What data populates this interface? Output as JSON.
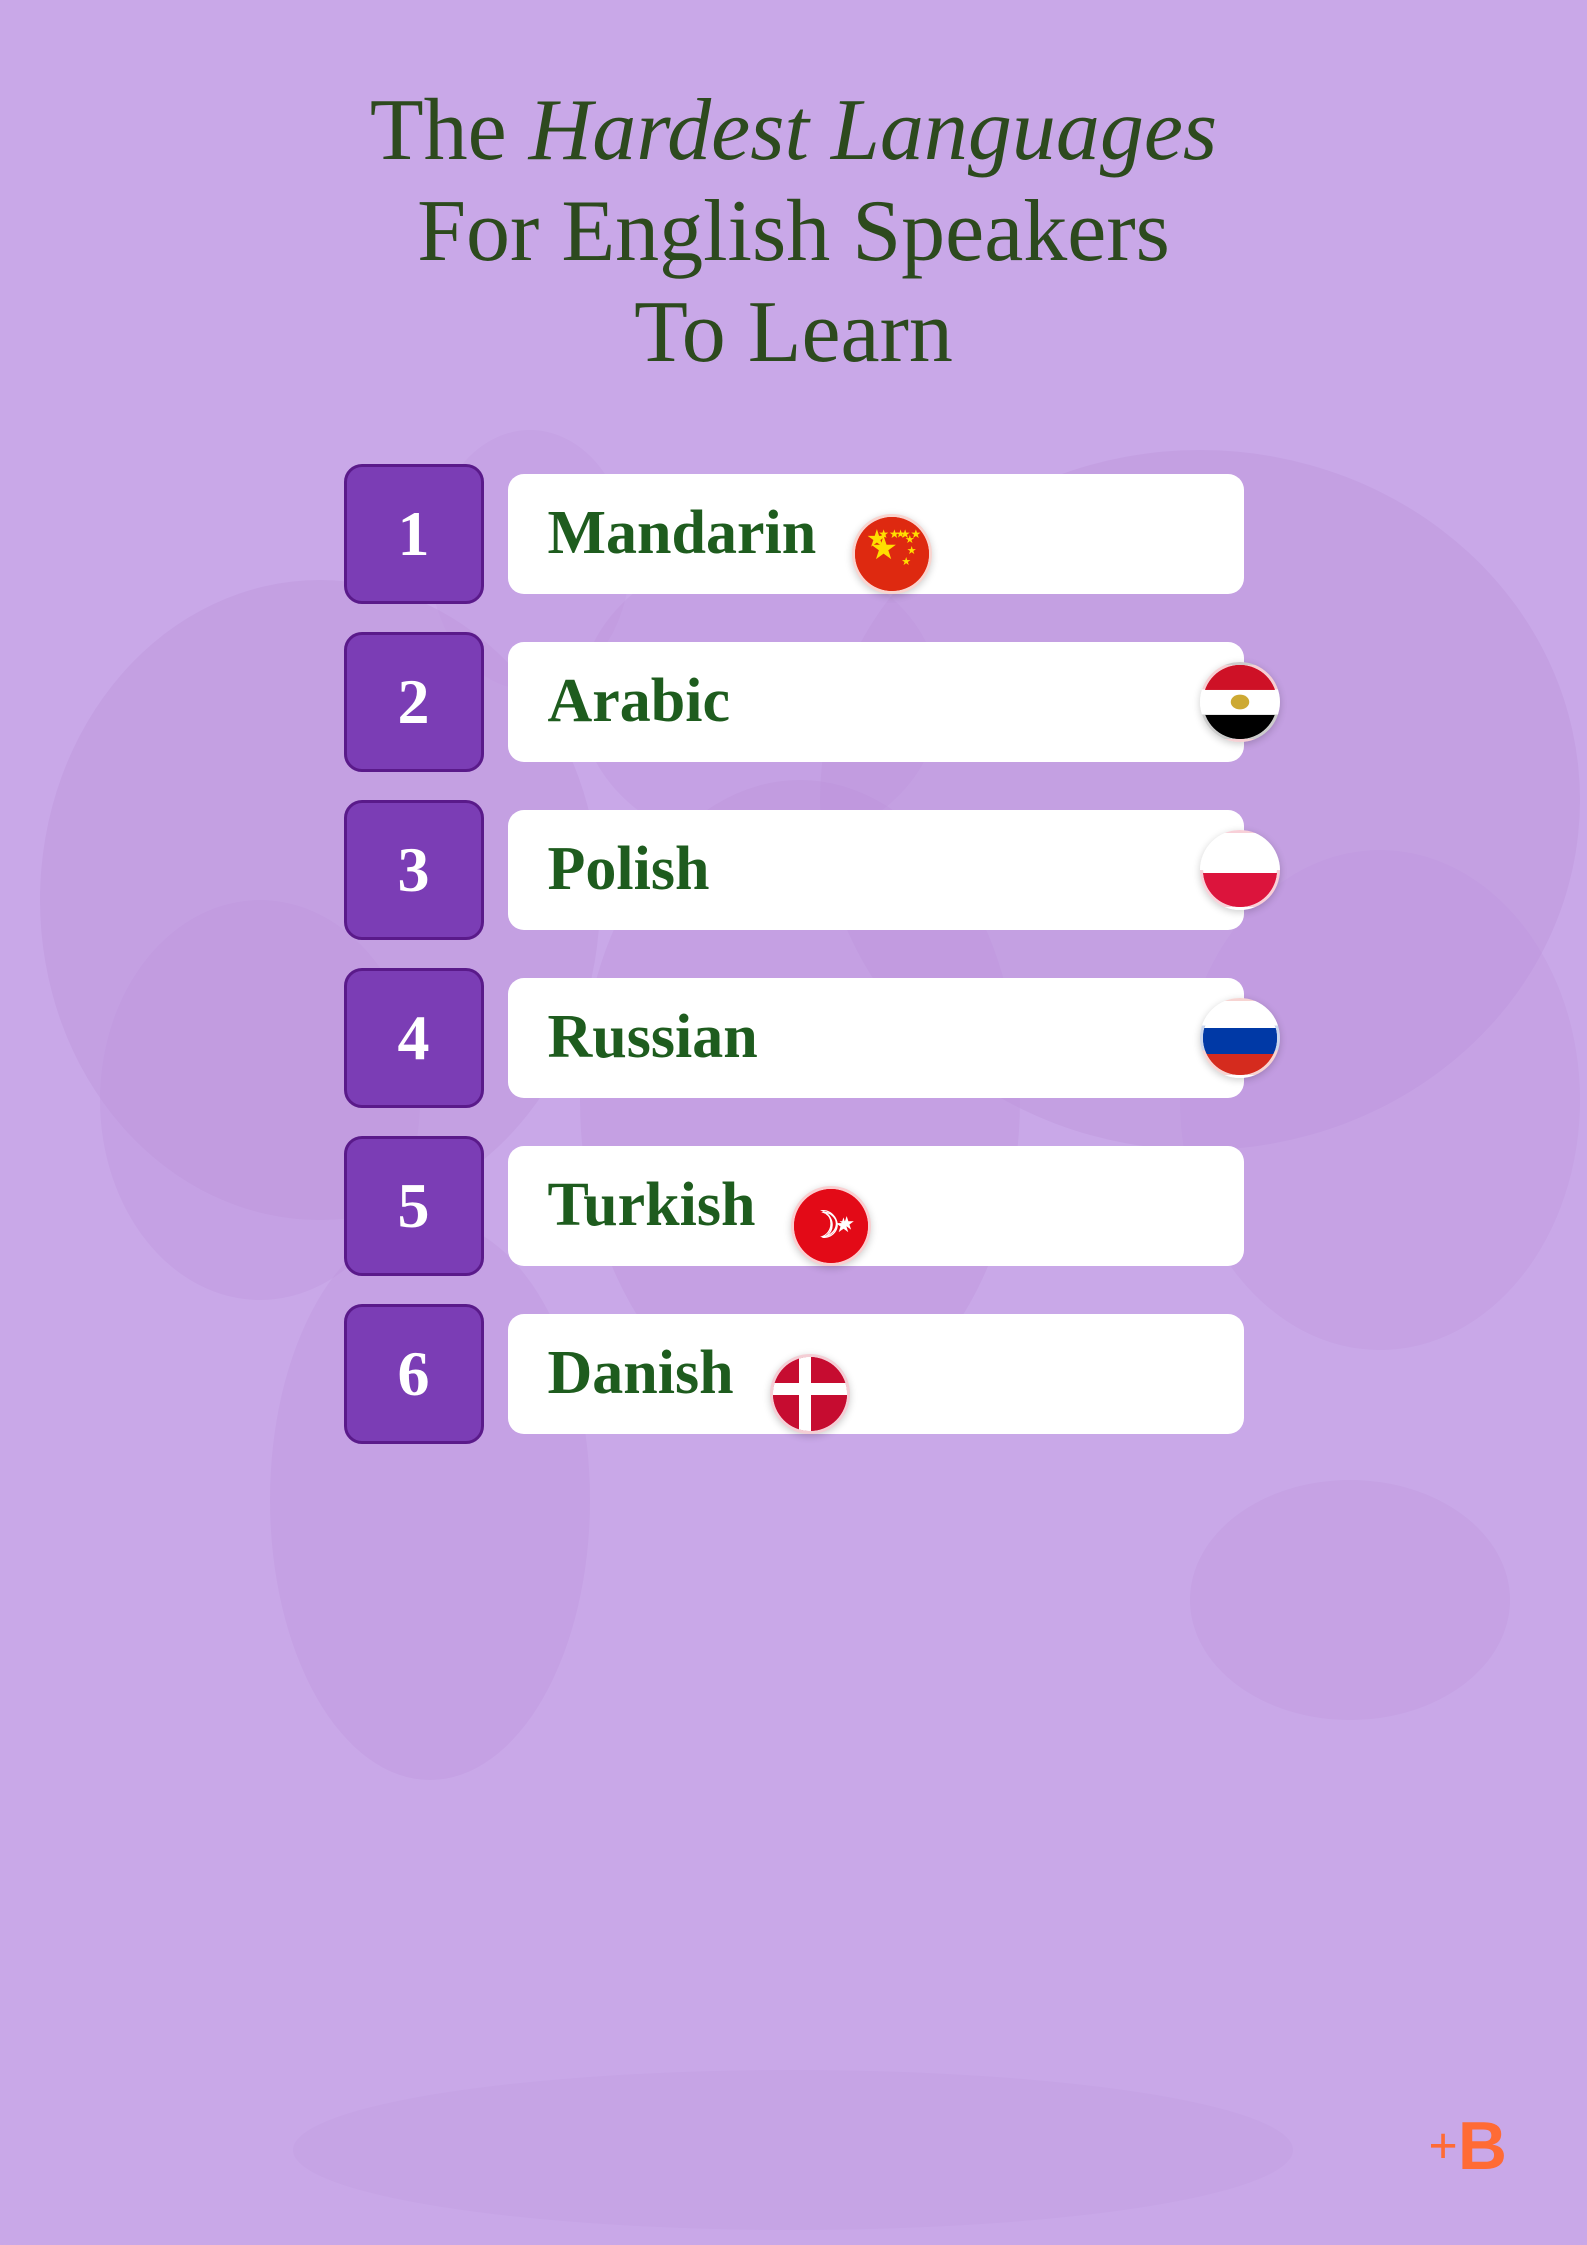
{
  "title": {
    "line1_prefix": "The ",
    "line1_italic": "Hardest Languages",
    "line2": "For English Speakers",
    "line3": "To Learn"
  },
  "languages": [
    {
      "rank": "1",
      "name": "Mandarin",
      "flag_type": "china"
    },
    {
      "rank": "2",
      "name": "Arabic",
      "flag_type": "egypt"
    },
    {
      "rank": "3",
      "name": "Polish",
      "flag_type": "poland"
    },
    {
      "rank": "4",
      "name": "Russian",
      "flag_type": "russia"
    },
    {
      "rank": "5",
      "name": "Turkish",
      "flag_type": "turkey"
    },
    {
      "rank": "6",
      "name": "Danish",
      "flag_type": "denmark"
    }
  ],
  "brand": {
    "plus": "+",
    "letter": "B"
  },
  "colors": {
    "background": "#c9a8e8",
    "rank_box": "#7b3db5",
    "title_text": "#2d4a1e",
    "language_text": "#1e5c1e",
    "brand_color": "#ff6b35"
  }
}
